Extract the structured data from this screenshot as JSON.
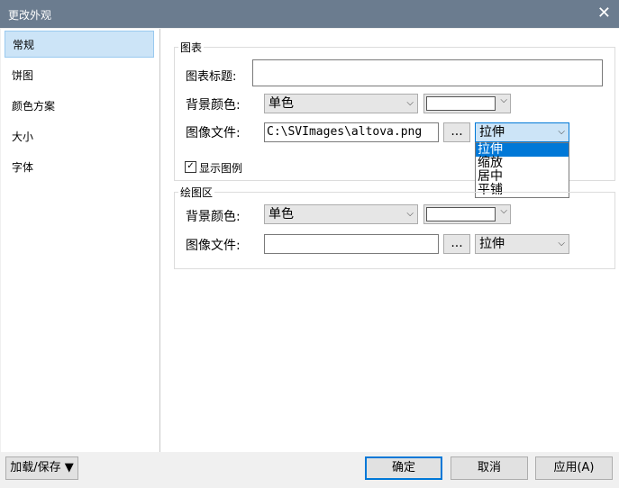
{
  "window": {
    "title": "更改外观",
    "close_glyph": "✕"
  },
  "sidebar": {
    "items": [
      {
        "label": "常规",
        "selected": true
      },
      {
        "label": "饼图"
      },
      {
        "label": "颜色方案"
      },
      {
        "label": "大小"
      },
      {
        "label": "字体"
      }
    ]
  },
  "chart_group": {
    "legend": "图表",
    "title_label": "图表标题:",
    "title_value": "",
    "bg_color_label": "背景颜色:",
    "bg_color_mode": "单色",
    "bg_color_value": "#ffffff",
    "image_file_label": "图像文件:",
    "image_file_value": "C:\\SVImages\\altova.png",
    "browse_label": "...",
    "image_mode": "拉伸",
    "image_mode_options": [
      "拉伸",
      "缩放",
      "居中",
      "平铺"
    ],
    "show_legend_label": "显示图例",
    "show_legend_checked": true
  },
  "plot_group": {
    "legend": "绘图区",
    "bg_color_label": "背景颜色:",
    "bg_color_mode": "单色",
    "bg_color_value": "#ffffff",
    "image_file_label": "图像文件:",
    "image_file_value": "",
    "browse_label": "...",
    "image_mode": "拉伸"
  },
  "footer": {
    "load_save_label": "加载/保存 ▼",
    "ok_label": "确定",
    "cancel_label": "取消",
    "apply_label": "应用(A)"
  },
  "icons": {
    "checkmark": "✓",
    "chevron_down": "⌵"
  }
}
